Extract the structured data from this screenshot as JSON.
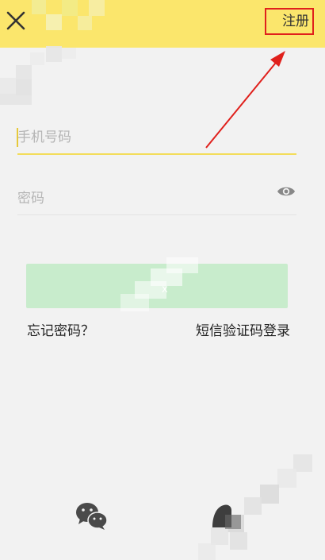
{
  "header": {
    "close_icon": "close-icon",
    "register_label": "注册"
  },
  "form": {
    "phone_placeholder": "手机号码",
    "password_placeholder": "密码",
    "eye_icon": "eye-icon"
  },
  "login_button_label": "",
  "links": {
    "forgot_password": "忘记密码？",
    "sms_login": "短信验证码登录"
  },
  "social": {
    "wechat_icon": "wechat-icon",
    "other_icon": "other-login-icon"
  },
  "colors": {
    "header_bg": "#fbe66c",
    "login_button_bg": "#c8eccc",
    "highlight_box": "#e0201c",
    "input_underline_active": "#f3dd5a"
  }
}
